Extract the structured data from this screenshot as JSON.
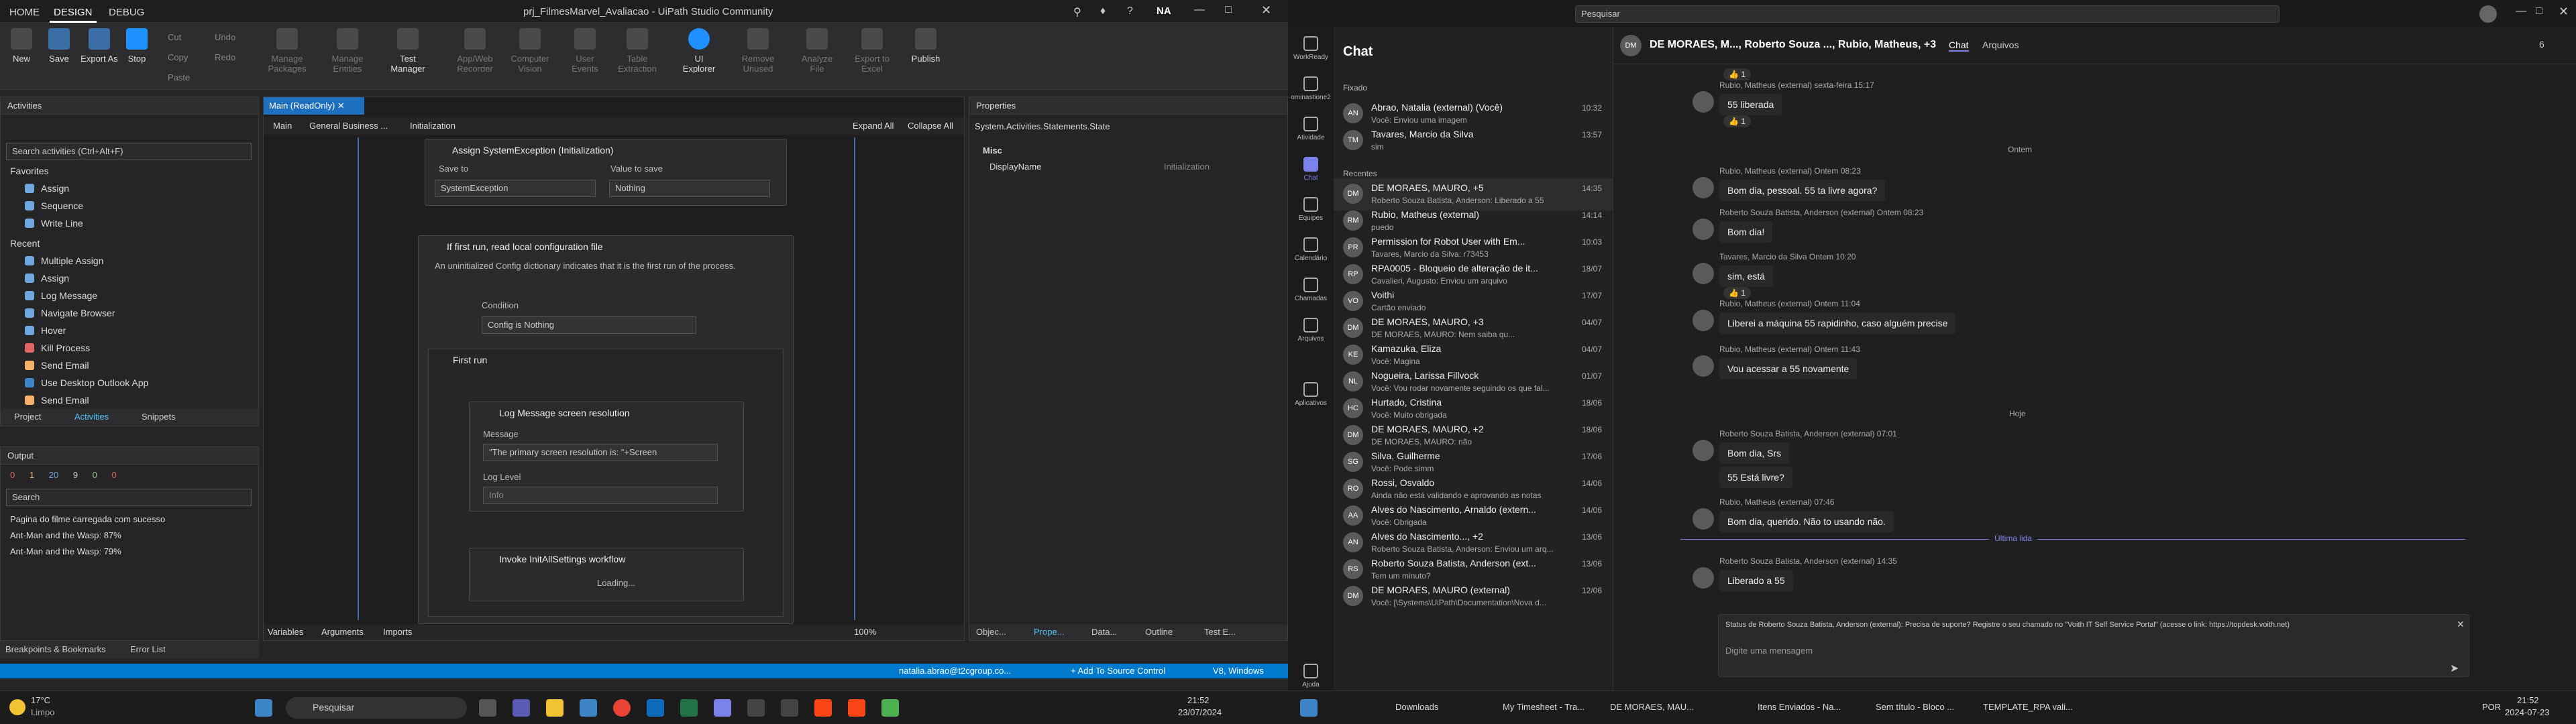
{
  "uipath": {
    "title": "prj_FilmesMarvel_Avaliacao - UiPath Studio Community",
    "user_initials": "NA",
    "tabs": [
      "HOME",
      "DESIGN",
      "DEBUG"
    ],
    "ribbon": [
      {
        "label": "New"
      },
      {
        "label": "Save"
      },
      {
        "label": "Export As"
      },
      {
        "label": "Stop"
      },
      {
        "label": "Manage Packages"
      },
      {
        "label": "Manage Entities"
      },
      {
        "label": "Test Manager"
      },
      {
        "label": "App/Web Recorder"
      },
      {
        "label": "Computer Vision"
      },
      {
        "label": "User Events"
      },
      {
        "label": "Table Extraction"
      },
      {
        "label": "UI Explorer"
      },
      {
        "label": "Remove Unused"
      },
      {
        "label": "Analyze File"
      },
      {
        "label": "Export to Excel"
      },
      {
        "label": "Publish"
      }
    ],
    "ribbon_small": [
      "Cut",
      "Copy",
      "Paste",
      "Undo",
      "Redo"
    ],
    "activities": {
      "header": "Activities",
      "search_placeholder": "Search activities (Ctrl+Alt+F)",
      "favorites_label": "Favorites",
      "favorites": [
        "Assign",
        "Sequence",
        "Write Line"
      ],
      "recent_label": "Recent",
      "recent": [
        "Multiple Assign",
        "Assign",
        "Log Message",
        "Navigate Browser",
        "Hover",
        "Kill Process",
        "Send Email",
        "Use Desktop Outlook App",
        "Send Email"
      ],
      "bottom_tabs": [
        "Project",
        "Activities",
        "Snippets"
      ]
    },
    "output": {
      "header": "Output",
      "counts": [
        "0",
        "1",
        "20",
        "9",
        "0",
        "0"
      ],
      "search_placeholder": "Search",
      "lines": [
        "Pagina do filme carregada com sucesso",
        "Ant-Man and the Wasp: 87%",
        "Ant-Man and the Wasp: 79%"
      ],
      "bottom_tabs": [
        "Breakpoints & Bookmarks",
        "Error List"
      ]
    },
    "designer": {
      "tab": "Main (ReadOnly)",
      "breadcrumb": [
        "Main",
        "General Business ...",
        "Initialization"
      ],
      "expand_all": "Expand All",
      "collapse_all": "Collapse All",
      "assign_card": {
        "title": "Assign SystemException (Initialization)",
        "save_to_label": "Save to",
        "value_label": "Value to save",
        "save_to": "SystemException",
        "value": "Nothing"
      },
      "if_card": {
        "title": "If first run, read local configuration file",
        "description": "An uninitialized Config dictionary indicates that it is the first run of the process.",
        "condition_label": "Condition",
        "condition": "Config is Nothing"
      },
      "first_run": "First run",
      "log_card": {
        "title": "Log Message screen resolution",
        "message_label": "Message",
        "message": "\"The primary screen resolution is: \"+Screen",
        "level_label": "Log Level",
        "level": "Info"
      },
      "invoke_card": {
        "title": "Invoke InitAllSettings workflow",
        "loading": "Loading..."
      },
      "bottom_tabs": [
        "Variables",
        "Arguments",
        "Imports"
      ],
      "zoom": "100%"
    },
    "properties": {
      "header": "Properties",
      "type": "System.Activities.Statements.State",
      "category": "Misc",
      "display_name_label": "DisplayName",
      "display_name_value": "Initialization",
      "bottom_tabs": [
        "Objec...",
        "Prope...",
        "Data...",
        "Outline",
        "Test E..."
      ]
    },
    "status": {
      "user": "natalia.abrao@t2cgroup.co...",
      "source_control": "+ Add To Source Control",
      "target": "V8, Windows"
    }
  },
  "teams": {
    "search_placeholder": "Pesquisar",
    "rail": [
      "WorkReady",
      "ominastione2",
      "Atividade",
      "Chat",
      "Equipes",
      "Calendário",
      "Chamadas",
      "Arquivos",
      "Aplicativos",
      "Ajuda"
    ],
    "chat_title": "Chat",
    "pinned_label": "Fixado",
    "recent_label": "Recentes",
    "chats": [
      {
        "initials": "AN",
        "name": "Abrao, Natalia (external) (Você)",
        "preview": "Você: Enviou uma imagem",
        "date": "10:32"
      },
      {
        "initials": "TM",
        "name": "Tavares, Marcio da Silva",
        "preview": "sim",
        "date": "13:57"
      },
      {
        "initials": "DM",
        "name": "DE MORAES, MAURO, +5",
        "preview": "Roberto Souza Batista, Anderson: Liberado a 55",
        "date": "14:35"
      },
      {
        "initials": "RM",
        "name": "Rubio, Matheus (external)",
        "preview": "puedo",
        "date": "14:14"
      },
      {
        "initials": "PR",
        "name": "Permission for Robot User with Em...",
        "preview": "Tavares, Marcio da Silva: r73453",
        "date": "10:03"
      },
      {
        "initials": "RP",
        "name": "RPA0005 - Bloqueio de alteração de it...",
        "preview": "Cavalieri, Augusto: Enviou um arquivo",
        "date": "18/07"
      },
      {
        "initials": "VO",
        "name": "Voithi",
        "preview": "Cartão enviado",
        "date": "17/07"
      },
      {
        "initials": "DM",
        "name": "DE MORAES, MAURO, +3",
        "preview": "DE MORAES, MAURO: Nem saiba qu...",
        "date": "04/07"
      },
      {
        "initials": "KE",
        "name": "Kamazuka, Eliza",
        "preview": "Você: Magina",
        "date": "04/07"
      },
      {
        "initials": "NL",
        "name": "Nogueira, Larissa Fillvock",
        "preview": "Você: Vou rodar novamente seguindo os que fal...",
        "date": "01/07"
      },
      {
        "initials": "HC",
        "name": "Hurtado, Cristina",
        "preview": "Você: Muito obrigada",
        "date": "18/06"
      },
      {
        "initials": "DM",
        "name": "DE MORAES, MAURO, +2",
        "preview": "DE MORAES, MAURO: não",
        "date": "18/06"
      },
      {
        "initials": "SG",
        "name": "Silva, Guilherme",
        "preview": "Você: Pode simm",
        "date": "17/06"
      },
      {
        "initials": "RO",
        "name": "Rossi, Osvaldo",
        "preview": "Ainda não está validando e aprovando as notas",
        "date": "14/06"
      },
      {
        "initials": "AA",
        "name": "Alves do Nascimento, Arnaldo (extern...",
        "preview": "Você: Obrigada",
        "date": "14/06"
      },
      {
        "initials": "AN",
        "name": "Alves do Nascimento..., +2",
        "preview": "Roberto Souza Batista, Anderson: Enviou um arq...",
        "date": "13/06"
      },
      {
        "initials": "RS",
        "name": "Roberto Souza Batista, Anderson (ext...",
        "preview": "Tem um minuto?",
        "date": "13/06"
      },
      {
        "initials": "DM",
        "name": "DE MORAES, MAURO (external)",
        "preview": "Você: [\\Systems\\UiPath\\Documentation\\Nova d...",
        "date": "12/06"
      }
    ],
    "conversation": {
      "title": "DE MORAES, M..., Roberto Souza ..., Rubio, Matheus, +3",
      "tabs": [
        "Chat",
        "Arquivos"
      ],
      "participants": "6",
      "day_ontem": "Ontem",
      "day_hoje": "Hoje",
      "last_read": "Última lida",
      "messages": [
        {
          "meta": "",
          "text": "",
          "react": "1"
        },
        {
          "meta": "Rubio, Matheus (external)   sexta-feira 15:17",
          "text": "55 liberada",
          "react": "1"
        },
        {
          "meta": "Rubio, Matheus (external)   Ontem 08:23",
          "text": "Bom dia, pessoal. 55 ta livre agora?"
        },
        {
          "meta": "Roberto Souza Batista, Anderson (external)   Ontem 08:23",
          "text": "Bom dia!"
        },
        {
          "meta": "Tavares, Marcio da Silva   Ontem 10:20",
          "text": "sim, está",
          "react": "1"
        },
        {
          "meta": "Rubio, Matheus (external)   Ontem 11:04",
          "text": "Liberei a máquina 55 rapidinho, caso alguém precise"
        },
        {
          "meta": "Rubio, Matheus (external)   Ontem 11:43",
          "text": "Vou acessar a 55 novamente"
        },
        {
          "meta": "Roberto Souza Batista, Anderson (external)   07:01",
          "text": "Bom dia, Srs"
        },
        {
          "meta": "",
          "text": "55 Está livre?"
        },
        {
          "meta": "Rubio, Matheus (external)   07:46",
          "text": "Bom dia, querido. Não to usando não."
        },
        {
          "meta": "Roberto Souza Batista, Anderson (external)   14:35",
          "text": "Liberado a 55"
        }
      ],
      "notice": "Status de Roberto Souza Batista, Anderson (external): Precisa de suporte? Registre o seu chamado no \"Voith IT Self Service Portal\" (acesse o link: https://topdesk.voith.net)",
      "compose_placeholder": "Digite uma mensagem"
    }
  },
  "taskbar": {
    "weather_temp": "17°C",
    "weather_desc": "Limpo",
    "search": "Pesquisar",
    "time_left": "21:52",
    "date_left": "23/07/2024",
    "lang": "POR",
    "apps_right": [
      "Downloads",
      "My Timesheet - Tra...",
      "DE MORAES, MAU...",
      "Itens Enviados - Na...",
      "Sem título - Bloco ...",
      "TEMPLATE_RPA vali..."
    ],
    "time_right": "21:52",
    "date_right": "2024-07-23"
  },
  "colors": {
    "accent": "#007acc",
    "teams_accent": "#7b83eb",
    "uipath_orange": "#fa4616"
  }
}
